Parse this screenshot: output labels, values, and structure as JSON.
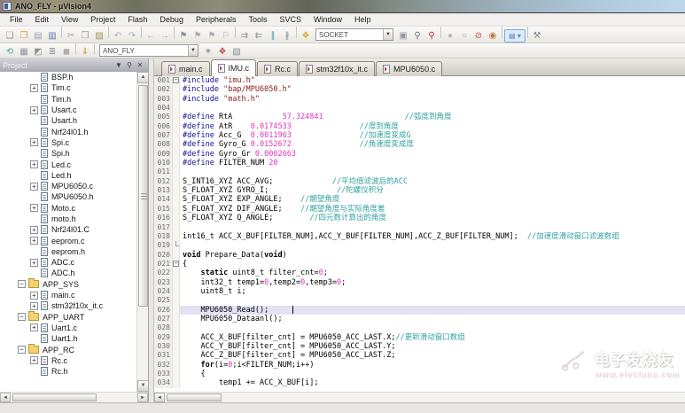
{
  "window": {
    "title": "ANO_FLY - µVision4"
  },
  "menu": {
    "items": [
      "File",
      "Edit",
      "View",
      "Project",
      "Flash",
      "Debug",
      "Peripherals",
      "Tools",
      "SVCS",
      "Window",
      "Help"
    ]
  },
  "toolbar1": {
    "icons_before": [
      "new-file",
      "open",
      "save",
      "save-all",
      "sep",
      "cut",
      "copy",
      "paste",
      "sep",
      "undo",
      "redo",
      "sep",
      "nav-back",
      "nav-forward",
      "sep",
      "bookmark-toggle",
      "bookmark-prev",
      "bookmark-next",
      "bookmark-clear",
      "sep",
      "indent",
      "outdent",
      "comment",
      "uncomment",
      "sep",
      "flash-menu"
    ],
    "search_combo": "SOCKET",
    "icons_after": [
      "find-in-files",
      "find",
      "find-magnifier",
      "sep",
      "run-gray-circle",
      "run-white-circle",
      "kill-breakpoints",
      "enable-breakpoints",
      "sep",
      "window-layout",
      "sep",
      "configure-wrench"
    ]
  },
  "toolbar2": {
    "icons_before": [
      "debug-session",
      "insert-output",
      "breakpoints-window",
      "watch-window",
      "memory-window",
      "sep",
      "load-flash",
      "sep"
    ],
    "target_combo": "ANO_FLY",
    "icons_after": [
      "target-options",
      "configure-blocks",
      "manage-components"
    ]
  },
  "project_panel": {
    "title": "Project",
    "tree": [
      {
        "label": "BSP.h",
        "type": "h",
        "exp": "none",
        "depth": 2
      },
      {
        "label": "Tim.c",
        "type": "c",
        "exp": "plus",
        "depth": 2
      },
      {
        "label": "Tim.h",
        "type": "h",
        "exp": "none",
        "depth": 2
      },
      {
        "label": "Usart.c",
        "type": "c",
        "exp": "plus",
        "depth": 2
      },
      {
        "label": "Usart.h",
        "type": "h",
        "exp": "none",
        "depth": 2
      },
      {
        "label": "Nrf24l01.h",
        "type": "h",
        "exp": "none",
        "depth": 2
      },
      {
        "label": "Spi.c",
        "type": "c",
        "exp": "plus",
        "depth": 2
      },
      {
        "label": "Spi.h",
        "type": "h",
        "exp": "none",
        "depth": 2
      },
      {
        "label": "Led.c",
        "type": "c",
        "exp": "plus",
        "depth": 2
      },
      {
        "label": "Led.h",
        "type": "h",
        "exp": "none",
        "depth": 2
      },
      {
        "label": "MPU6050.c",
        "type": "c",
        "exp": "plus",
        "depth": 2
      },
      {
        "label": "MPU6050.h",
        "type": "h",
        "exp": "none",
        "depth": 2
      },
      {
        "label": "Moto.c",
        "type": "c",
        "exp": "plus",
        "depth": 2
      },
      {
        "label": "moto.h",
        "type": "h",
        "exp": "none",
        "depth": 2
      },
      {
        "label": "Nrf24l01.C",
        "type": "c",
        "exp": "plus",
        "depth": 2
      },
      {
        "label": "eeprom.c",
        "type": "c",
        "exp": "plus",
        "depth": 2
      },
      {
        "label": "eeprom.h",
        "type": "h",
        "exp": "none",
        "depth": 2
      },
      {
        "label": "ADC.c",
        "type": "c",
        "exp": "plus",
        "depth": 2
      },
      {
        "label": "ADC.h",
        "type": "h",
        "exp": "none",
        "depth": 2
      },
      {
        "label": "APP_SYS",
        "type": "folder",
        "exp": "minus",
        "depth": 1
      },
      {
        "label": "main.c",
        "type": "c",
        "exp": "plus",
        "depth": 2
      },
      {
        "label": "stm32f10x_it.c",
        "type": "c",
        "exp": "plus",
        "depth": 2
      },
      {
        "label": "APP_UART",
        "type": "folder",
        "exp": "minus",
        "depth": 1
      },
      {
        "label": "Uart1.c",
        "type": "c",
        "exp": "plus",
        "depth": 2
      },
      {
        "label": "Uart1.h",
        "type": "h",
        "exp": "none",
        "depth": 2
      },
      {
        "label": "APP_RC",
        "type": "folder",
        "exp": "minus",
        "depth": 1
      },
      {
        "label": "Rc.c",
        "type": "c",
        "exp": "plus",
        "depth": 2
      },
      {
        "label": "Rc.h",
        "type": "h",
        "exp": "none",
        "depth": 2
      }
    ]
  },
  "editor": {
    "tabs": [
      {
        "label": "main.c",
        "active": false
      },
      {
        "label": "IMU.c",
        "active": true
      },
      {
        "label": "Rc.c",
        "active": false
      },
      {
        "label": "stm32f10x_it.c",
        "active": false
      },
      {
        "label": "MPU6050.c",
        "active": false
      }
    ],
    "lines": [
      {
        "n": 1,
        "fold": "minus",
        "seg": [
          [
            "p",
            "#include"
          ],
          [
            "t",
            " "
          ],
          [
            "s",
            "\"imu.h\""
          ]
        ]
      },
      {
        "n": 2,
        "seg": [
          [
            "p",
            "#include"
          ],
          [
            "t",
            " "
          ],
          [
            "s",
            "\"bap/MPU6050.h\""
          ]
        ]
      },
      {
        "n": 3,
        "seg": [
          [
            "p",
            "#include"
          ],
          [
            "t",
            " "
          ],
          [
            "s",
            "\"math.h\""
          ]
        ]
      },
      {
        "n": 4,
        "seg": []
      },
      {
        "n": 5,
        "seg": [
          [
            "p",
            "#define"
          ],
          [
            "t",
            " RtA           "
          ],
          [
            "n2",
            "57.324841"
          ],
          [
            "t",
            "                  "
          ],
          [
            "c",
            "//弧度到角度"
          ]
        ]
      },
      {
        "n": 6,
        "seg": [
          [
            "p",
            "#define"
          ],
          [
            "t",
            " AtR    "
          ],
          [
            "n2",
            "0.0174533"
          ],
          [
            "t",
            "               "
          ],
          [
            "c",
            "//度到角度"
          ]
        ]
      },
      {
        "n": 7,
        "seg": [
          [
            "p",
            "#define"
          ],
          [
            "t",
            " Acc_G  "
          ],
          [
            "n2",
            "0.0011963"
          ],
          [
            "t",
            "               "
          ],
          [
            "c",
            "//加速度变成G"
          ]
        ]
      },
      {
        "n": 8,
        "seg": [
          [
            "p",
            "#define"
          ],
          [
            "t",
            " Gyro_G "
          ],
          [
            "n2",
            "0.0152672"
          ],
          [
            "t",
            "               "
          ],
          [
            "c",
            "//角速度变成度"
          ]
        ]
      },
      {
        "n": 9,
        "seg": [
          [
            "p",
            "#define"
          ],
          [
            "t",
            " Gyro_Gr "
          ],
          [
            "n2",
            "0.0002663"
          ]
        ]
      },
      {
        "n": 10,
        "seg": [
          [
            "p",
            "#define"
          ],
          [
            "t",
            " FILTER_NUM "
          ],
          [
            "n2",
            "20"
          ]
        ]
      },
      {
        "n": 11,
        "seg": []
      },
      {
        "n": 12,
        "seg": [
          [
            "t",
            "S_INT16_XYZ ACC_AVG;"
          ],
          [
            "t",
            "             "
          ],
          [
            "c",
            "//平均值滤波后的ACC"
          ]
        ]
      },
      {
        "n": 13,
        "seg": [
          [
            "t",
            "S_FLOAT_XYZ GYRO_I;"
          ],
          [
            "t",
            "               "
          ],
          [
            "c",
            "//陀螺仪积分"
          ]
        ]
      },
      {
        "n": 14,
        "seg": [
          [
            "t",
            "S_FLOAT_XYZ EXP_ANGLE;"
          ],
          [
            "t",
            "    "
          ],
          [
            "c",
            "//期望角度"
          ]
        ]
      },
      {
        "n": 15,
        "seg": [
          [
            "t",
            "S_FLOAT_XYZ DIF_ANGLE;"
          ],
          [
            "t",
            "    "
          ],
          [
            "c",
            "//期望角度与实际角度差"
          ]
        ]
      },
      {
        "n": 16,
        "seg": [
          [
            "t",
            "S_FLOAT_XYZ Q_ANGLE;"
          ],
          [
            "t",
            "        "
          ],
          [
            "c",
            "//四元数计算出的角度"
          ]
        ]
      },
      {
        "n": 17,
        "seg": []
      },
      {
        "n": 18,
        "seg": [
          [
            "t",
            "int16_t ACC_X_BUF[FILTER_NUM],ACC_Y_BUF[FILTER_NUM],ACC_Z_BUF[FILTER_NUM];"
          ],
          [
            "t",
            "  "
          ],
          [
            "c",
            "//加速度滑动窗口滤波数组"
          ]
        ]
      },
      {
        "n": 19,
        "fold": "end",
        "seg": []
      },
      {
        "n": 20,
        "seg": [
          [
            "k",
            "void"
          ],
          [
            "t",
            " Prepare_Data("
          ],
          [
            "k",
            "void"
          ],
          [
            "t",
            ")"
          ]
        ]
      },
      {
        "n": 21,
        "fold": "minus",
        "seg": [
          [
            "t",
            "{"
          ]
        ]
      },
      {
        "n": 22,
        "seg": [
          [
            "t",
            "    "
          ],
          [
            "k",
            "static"
          ],
          [
            "t",
            " uint8_t filter_cnt="
          ],
          [
            "n2",
            "0"
          ],
          [
            "t",
            ";"
          ]
        ]
      },
      {
        "n": 23,
        "seg": [
          [
            "t",
            "    int32_t temp1="
          ],
          [
            "n2",
            "0"
          ],
          [
            "t",
            ",temp2="
          ],
          [
            "n2",
            "0"
          ],
          [
            "t",
            ",temp3="
          ],
          [
            "n2",
            "0"
          ],
          [
            "t",
            ";"
          ]
        ]
      },
      {
        "n": 24,
        "seg": [
          [
            "t",
            "    uint8_t i;"
          ]
        ]
      },
      {
        "n": 25,
        "seg": []
      },
      {
        "n": 26,
        "highlight": true,
        "caret": true,
        "seg": [
          [
            "t",
            "    MPU6050_Read();"
          ]
        ]
      },
      {
        "n": 27,
        "seg": [
          [
            "t",
            "    MPU6050_Dataanl();"
          ]
        ]
      },
      {
        "n": 28,
        "seg": []
      },
      {
        "n": 29,
        "seg": [
          [
            "t",
            "    ACC_X_BUF[filter_cnt] = MPU6050_ACC_LAST.X;"
          ],
          [
            "c",
            "//更新滑动窗口数组"
          ]
        ]
      },
      {
        "n": 30,
        "seg": [
          [
            "t",
            "    ACC_Y_BUF[filter_cnt] = MPU6050_ACC_LAST.Y;"
          ]
        ]
      },
      {
        "n": 31,
        "seg": [
          [
            "t",
            "    ACC_Z_BUF[filter_cnt] = MPU6050_ACC_LAST.Z;"
          ]
        ]
      },
      {
        "n": 32,
        "seg": [
          [
            "t",
            "    "
          ],
          [
            "k",
            "for"
          ],
          [
            "t",
            "(i="
          ],
          [
            "n2",
            "0"
          ],
          [
            "t",
            ";i<FILTER_NUM;i++)"
          ]
        ]
      },
      {
        "n": 33,
        "seg": [
          [
            "t",
            "    {"
          ]
        ]
      },
      {
        "n": 34,
        "seg": [
          [
            "t",
            "        temp1 += ACC_X_BUF[i];"
          ]
        ]
      }
    ]
  },
  "watermark": {
    "line1": "电子发烧友",
    "line2": "www.elecfans.com"
  },
  "colors": {
    "preprocessor": "#10108e",
    "string": "#8b1a1a",
    "number": "#e135c0",
    "comment": "#2f9f9f",
    "line_highlight": "#e2e2f4",
    "active_tab": "#ffffff"
  }
}
